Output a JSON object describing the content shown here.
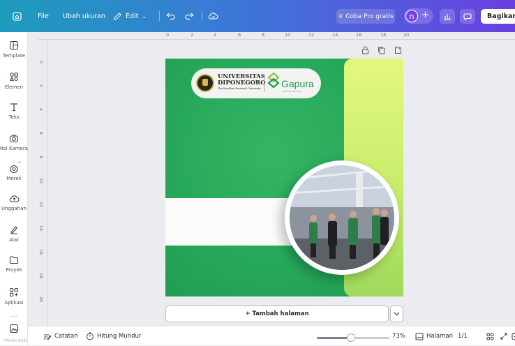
{
  "topbar": {
    "file_label": "File",
    "resize_label": "Ubah ukuran",
    "edit_label": "Edit",
    "pro_label": "Coba Pro gratis",
    "avatar_initial": "n",
    "share_label": "Bagikan"
  },
  "sidebar": {
    "items": [
      {
        "label": "Template",
        "icon": "template-icon"
      },
      {
        "label": "Elemen",
        "icon": "elements-icon"
      },
      {
        "label": "Teks",
        "icon": "text-icon"
      },
      {
        "label": "Rol Kamera",
        "icon": "camera-icon"
      },
      {
        "label": "Merek",
        "icon": "brand-icon"
      },
      {
        "label": "Unggahan",
        "icon": "upload-icon"
      },
      {
        "label": "Alat",
        "icon": "tools-icon"
      },
      {
        "label": "Proyek",
        "icon": "folder-icon"
      },
      {
        "label": "Aplikasi",
        "icon": "apps-icon"
      }
    ],
    "bottom_label": "Media Kolb"
  },
  "ruler": {
    "top_ticks": [
      "0",
      "2",
      "4",
      "6",
      "8",
      "10",
      "12",
      "14",
      "16",
      "18",
      "20"
    ],
    "left_ticks": [
      "0",
      "2",
      "4",
      "6",
      "8",
      "10",
      "12",
      "14",
      "16",
      "18",
      "20"
    ]
  },
  "design": {
    "university_line1": "UNIVERSITAS",
    "university_line2": "DIPONEGORO",
    "university_tagline": "The Excellent Research University",
    "partner_name": "Gapura",
    "partner_tagline": "AIRPORT SERVICES",
    "colors": {
      "green": "#26a85a",
      "lime": "#d8f47a",
      "white": "#fbfcfa"
    }
  },
  "add_page_label": "+ Tambah halaman",
  "bottombar": {
    "notes_label": "Catatan",
    "timer_label": "Hitung Mundur",
    "zoom_percent": "73%",
    "zoom_value": 0.47,
    "pages_label": "Halaman",
    "page_count": "1/1"
  }
}
